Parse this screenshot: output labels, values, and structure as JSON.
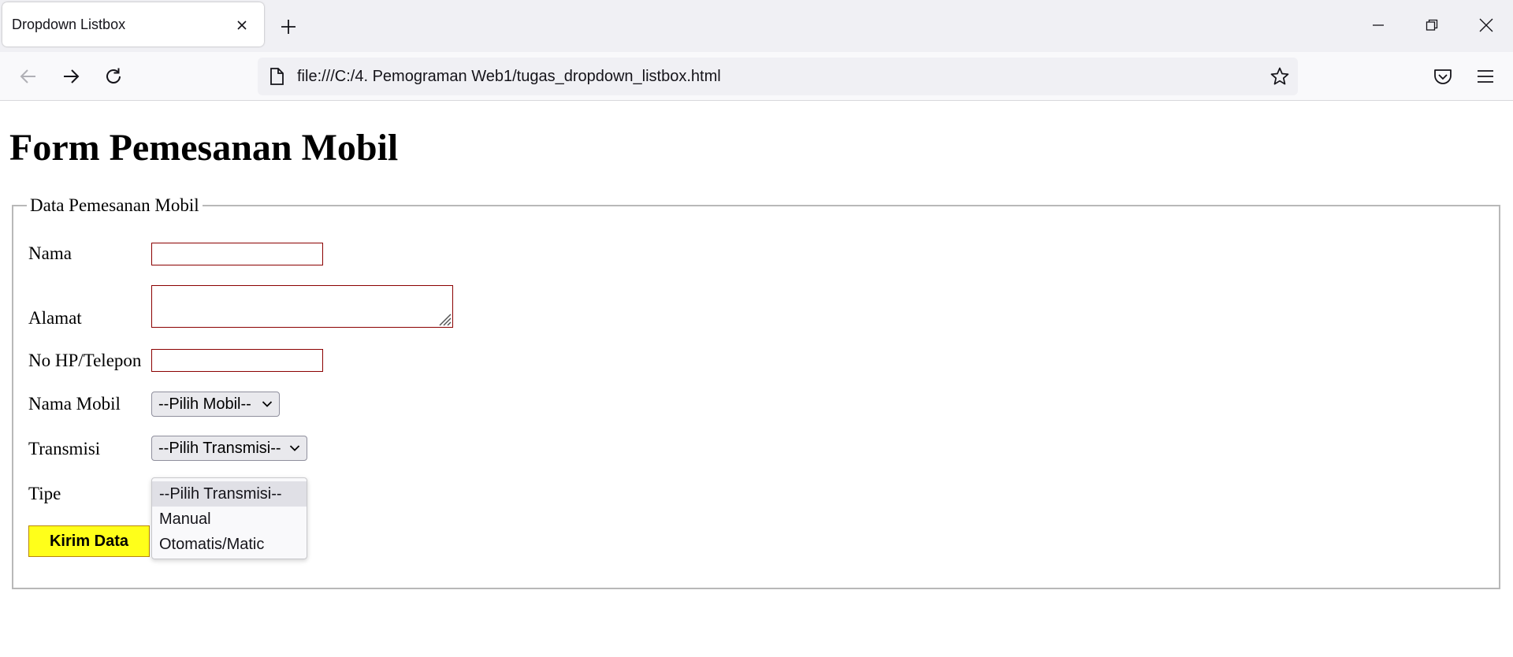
{
  "browser": {
    "tab_title": "Dropdown Listbox",
    "url": "file:///C:/4. Pemograman Web1/tugas_dropdown_listbox.html"
  },
  "page": {
    "heading": "Form Pemesanan Mobil",
    "legend": "Data Pemesanan Mobil",
    "labels": {
      "nama": "Nama",
      "alamat": "Alamat",
      "no_hp": "No HP/Telepon",
      "nama_mobil": "Nama Mobil",
      "transmisi": "Transmisi",
      "tipe": "Tipe"
    },
    "fields": {
      "nama_value": "",
      "alamat_value": "",
      "no_hp_value": ""
    },
    "select_mobil": {
      "selected": "--Pilih Mobil--"
    },
    "select_transmisi": {
      "selected": "--Pilih Transmisi--",
      "options": [
        "--Pilih Transmisi--",
        "Manual",
        "Otomatis/Matic"
      ]
    },
    "submit_label": "Kirim Data"
  },
  "colors": {
    "input_border": "#8b0000",
    "submit_bg": "#ffff1a",
    "fieldset_border": "#b8b8b8"
  }
}
